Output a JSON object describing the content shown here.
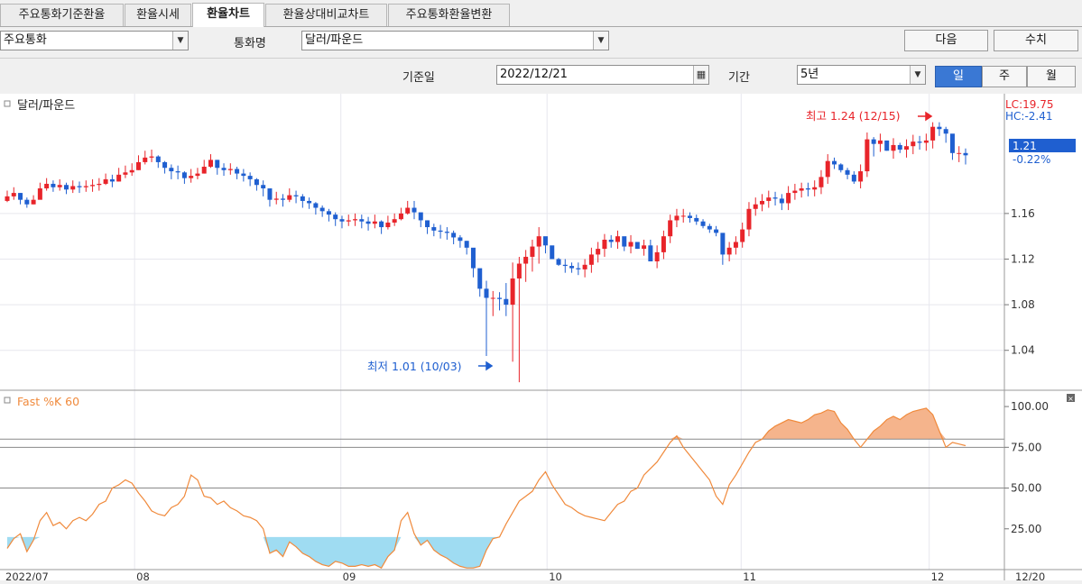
{
  "tabs": [
    {
      "label": "주요통화기준환율",
      "active": false
    },
    {
      "label": "환율시세",
      "active": false
    },
    {
      "label": "환율차트",
      "active": true
    },
    {
      "label": "환율상대비교차트",
      "active": false
    },
    {
      "label": "주요통화환율변환",
      "active": false
    }
  ],
  "toolbar": {
    "group_value": "주요통화",
    "currency_label": "통화명",
    "currency_value": "달러/파운드",
    "next_label": "다음",
    "input_label": "수치"
  },
  "filters": {
    "base_date_label": "기준일",
    "base_date_value": "2022/12/21",
    "period_label": "기간",
    "period_value": "5년",
    "interval_options": [
      {
        "label": "일",
        "selected": true
      },
      {
        "label": "주",
        "selected": false
      },
      {
        "label": "월",
        "selected": false
      }
    ]
  },
  "colors": {
    "up": "#e8242a",
    "down": "#1f5fd0",
    "line": "#f08a3c",
    "fill_high": "#f5b48c",
    "fill_low": "#9fdcf2",
    "accent_blue": "#3a78d4"
  },
  "chart_data": [
    {
      "type": "candlestick",
      "title": "달러/파운드",
      "y_ticks": [
        "1.16",
        "1.12",
        "1.08",
        "1.04"
      ],
      "ylim": [
        1.005,
        1.265
      ],
      "x_ticks": [
        "2022/07",
        "08",
        "09",
        "10",
        "11",
        "12"
      ],
      "right_axis_label_bottom": "12/20",
      "lc_label": "LC:19.75",
      "hc_label": "HC:-2.41",
      "last_value": "1.21",
      "last_change": "-0.22%",
      "annotation_high": "최고 1.24 (12/15)",
      "annotation_low": "최저 1.01 (10/03)",
      "closes": [
        1.175,
        1.178,
        1.172,
        1.168,
        1.172,
        1.182,
        1.186,
        1.183,
        1.185,
        1.181,
        1.184,
        1.183,
        1.184,
        1.185,
        1.186,
        1.19,
        1.188,
        1.194,
        1.196,
        1.198,
        1.205,
        1.209,
        1.21,
        1.205,
        1.2,
        1.197,
        1.196,
        1.191,
        1.193,
        1.195,
        1.201,
        1.207,
        1.2,
        1.198,
        1.199,
        1.195,
        1.193,
        1.19,
        1.185,
        1.182,
        1.172,
        1.173,
        1.172,
        1.176,
        1.175,
        1.171,
        1.169,
        1.165,
        1.162,
        1.159,
        1.155,
        1.153,
        1.154,
        1.155,
        1.153,
        1.151,
        1.153,
        1.148,
        1.152,
        1.155,
        1.16,
        1.165,
        1.161,
        1.154,
        1.148,
        1.145,
        1.144,
        1.143,
        1.139,
        1.136,
        1.13,
        1.112,
        1.094,
        1.086,
        1.086,
        1.085,
        1.08,
        1.103,
        1.116,
        1.122,
        1.131,
        1.14,
        1.132,
        1.12,
        1.115,
        1.114,
        1.112,
        1.111,
        1.115,
        1.124,
        1.129,
        1.137,
        1.135,
        1.14,
        1.131,
        1.135,
        1.129,
        1.132,
        1.118,
        1.126,
        1.14,
        1.154,
        1.158,
        1.158,
        1.156,
        1.153,
        1.149,
        1.146,
        1.143,
        1.124,
        1.13,
        1.135,
        1.146,
        1.164,
        1.168,
        1.171,
        1.174,
        1.173,
        1.169,
        1.178,
        1.18,
        1.182,
        1.181,
        1.183,
        1.192,
        1.206,
        1.203,
        1.198,
        1.194,
        1.188,
        1.197,
        1.225,
        1.221,
        1.224,
        1.215,
        1.22,
        1.216,
        1.219,
        1.223,
        1.222,
        1.224,
        1.236,
        1.234,
        1.23,
        1.213,
        1.213,
        1.211
      ],
      "lows": [
        1.17,
        1.172,
        1.168,
        1.165,
        1.168,
        1.176,
        1.18,
        1.179,
        1.18,
        1.177,
        1.178,
        1.178,
        1.179,
        1.179,
        1.18,
        1.185,
        1.183,
        1.188,
        1.191,
        1.193,
        1.198,
        1.203,
        1.205,
        1.2,
        1.195,
        1.19,
        1.19,
        1.186,
        1.187,
        1.19,
        1.195,
        1.2,
        1.194,
        1.193,
        1.194,
        1.19,
        1.188,
        1.184,
        1.18,
        1.175,
        1.166,
        1.168,
        1.166,
        1.17,
        1.169,
        1.165,
        1.164,
        1.159,
        1.157,
        1.153,
        1.149,
        1.147,
        1.149,
        1.149,
        1.147,
        1.145,
        1.147,
        1.142,
        1.146,
        1.149,
        1.154,
        1.159,
        1.155,
        1.148,
        1.142,
        1.14,
        1.138,
        1.137,
        1.133,
        1.13,
        1.124,
        1.104,
        1.087,
        1.035,
        1.07,
        1.075,
        1.07,
        1.03,
        1.012,
        1.1,
        1.109,
        1.116,
        1.125,
        1.126,
        1.114,
        1.108,
        1.108,
        1.106,
        1.104,
        1.108,
        1.117,
        1.122,
        1.13,
        1.129,
        1.127,
        1.125,
        1.129,
        1.123,
        1.121,
        1.112,
        1.12,
        1.134,
        1.148,
        1.152,
        1.152,
        1.15,
        1.147,
        1.143,
        1.14,
        1.115,
        1.118,
        1.124,
        1.13,
        1.14,
        1.158,
        1.162,
        1.165,
        1.167,
        1.163,
        1.163,
        1.172,
        1.174,
        1.175,
        1.175,
        1.177,
        1.186,
        1.199,
        1.196,
        1.19,
        1.186,
        1.182,
        1.192,
        1.21,
        1.214,
        1.215,
        1.208,
        1.213,
        1.209,
        1.212,
        1.216,
        1.215,
        1.217,
        1.228,
        1.222,
        1.207,
        1.205,
        1.203
      ],
      "highs": [
        1.18,
        1.183,
        1.178,
        1.174,
        1.176,
        1.187,
        1.191,
        1.189,
        1.19,
        1.187,
        1.189,
        1.188,
        1.189,
        1.19,
        1.191,
        1.195,
        1.194,
        1.2,
        1.202,
        1.204,
        1.211,
        1.215,
        1.216,
        1.211,
        1.206,
        1.203,
        1.202,
        1.197,
        1.199,
        1.2,
        1.207,
        1.212,
        1.207,
        1.204,
        1.204,
        1.201,
        1.199,
        1.196,
        1.191,
        1.189,
        1.177,
        1.179,
        1.177,
        1.182,
        1.18,
        1.177,
        1.174,
        1.17,
        1.167,
        1.164,
        1.161,
        1.158,
        1.159,
        1.16,
        1.159,
        1.157,
        1.159,
        1.154,
        1.158,
        1.16,
        1.165,
        1.171,
        1.171,
        1.16,
        1.154,
        1.151,
        1.15,
        1.148,
        1.145,
        1.141,
        1.136,
        1.119,
        1.1,
        1.101,
        1.092,
        1.091,
        1.099,
        1.117,
        1.122,
        1.128,
        1.137,
        1.148,
        1.139,
        1.126,
        1.121,
        1.12,
        1.117,
        1.117,
        1.12,
        1.13,
        1.135,
        1.142,
        1.141,
        1.145,
        1.137,
        1.141,
        1.135,
        1.137,
        1.137,
        1.132,
        1.145,
        1.159,
        1.164,
        1.164,
        1.161,
        1.159,
        1.155,
        1.151,
        1.149,
        1.13,
        1.135,
        1.14,
        1.152,
        1.17,
        1.174,
        1.177,
        1.18,
        1.179,
        1.177,
        1.184,
        1.186,
        1.187,
        1.187,
        1.189,
        1.198,
        1.212,
        1.209,
        1.204,
        1.2,
        1.197,
        1.203,
        1.231,
        1.227,
        1.23,
        1.221,
        1.226,
        1.222,
        1.225,
        1.229,
        1.228,
        1.23,
        1.24,
        1.24,
        1.236,
        1.219,
        1.219,
        1.217
      ]
    },
    {
      "type": "line",
      "title": "Fast %K 60",
      "y_ticks": [
        "100.00",
        "75.00",
        "50.00",
        "25.00"
      ],
      "ylim": [
        0,
        110
      ],
      "threshold_high": 80,
      "threshold_low": 20,
      "values": [
        13,
        19,
        22,
        11,
        18,
        30,
        35,
        27,
        29,
        25,
        30,
        32,
        30,
        34,
        40,
        42,
        50,
        52,
        55,
        53,
        47,
        42,
        36,
        34,
        33,
        38,
        40,
        45,
        58,
        55,
        45,
        44,
        40,
        42,
        38,
        36,
        33,
        32,
        30,
        25,
        10,
        12,
        8,
        17,
        14,
        10,
        8,
        5,
        3,
        2,
        5,
        4,
        2,
        2,
        3,
        2,
        3,
        1,
        8,
        12,
        30,
        35,
        22,
        15,
        18,
        12,
        9,
        7,
        4,
        2,
        1,
        1,
        2,
        12,
        19,
        20,
        28,
        35,
        42,
        45,
        48,
        55,
        60,
        52,
        46,
        40,
        38,
        35,
        33,
        32,
        31,
        30,
        35,
        40,
        42,
        48,
        50,
        58,
        62,
        66,
        72,
        78,
        82,
        75,
        70,
        65,
        60,
        55,
        45,
        40,
        52,
        58,
        65,
        72,
        78,
        80,
        85,
        88,
        90,
        92,
        91,
        90,
        92,
        95,
        96,
        98,
        97,
        90,
        86,
        80,
        75,
        80,
        85,
        88,
        92,
        94,
        92,
        95,
        97,
        98,
        99,
        95,
        85,
        75,
        78,
        77,
        76
      ]
    }
  ]
}
